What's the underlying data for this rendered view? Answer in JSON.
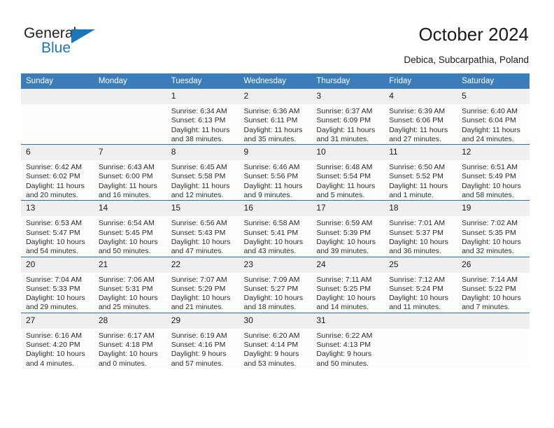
{
  "brand": {
    "name_top": "General",
    "name_bottom": "Blue",
    "accent_color": "#1b75bb"
  },
  "header": {
    "title": "October 2024",
    "subtitle": "Debica, Subcarpathia, Poland"
  },
  "calendar": {
    "header_color": "#3b7cba",
    "weekdays": [
      "Sunday",
      "Monday",
      "Tuesday",
      "Wednesday",
      "Thursday",
      "Friday",
      "Saturday"
    ],
    "weeks": [
      [
        {
          "day": "",
          "blank": true
        },
        {
          "day": "",
          "blank": true
        },
        {
          "day": "1",
          "sunrise": "Sunrise: 6:34 AM",
          "sunset": "Sunset: 6:13 PM",
          "daylight1": "Daylight: 11 hours",
          "daylight2": "and 38 minutes."
        },
        {
          "day": "2",
          "sunrise": "Sunrise: 6:36 AM",
          "sunset": "Sunset: 6:11 PM",
          "daylight1": "Daylight: 11 hours",
          "daylight2": "and 35 minutes."
        },
        {
          "day": "3",
          "sunrise": "Sunrise: 6:37 AM",
          "sunset": "Sunset: 6:09 PM",
          "daylight1": "Daylight: 11 hours",
          "daylight2": "and 31 minutes."
        },
        {
          "day": "4",
          "sunrise": "Sunrise: 6:39 AM",
          "sunset": "Sunset: 6:06 PM",
          "daylight1": "Daylight: 11 hours",
          "daylight2": "and 27 minutes."
        },
        {
          "day": "5",
          "sunrise": "Sunrise: 6:40 AM",
          "sunset": "Sunset: 6:04 PM",
          "daylight1": "Daylight: 11 hours",
          "daylight2": "and 24 minutes."
        }
      ],
      [
        {
          "day": "6",
          "sunrise": "Sunrise: 6:42 AM",
          "sunset": "Sunset: 6:02 PM",
          "daylight1": "Daylight: 11 hours",
          "daylight2": "and 20 minutes."
        },
        {
          "day": "7",
          "sunrise": "Sunrise: 6:43 AM",
          "sunset": "Sunset: 6:00 PM",
          "daylight1": "Daylight: 11 hours",
          "daylight2": "and 16 minutes."
        },
        {
          "day": "8",
          "sunrise": "Sunrise: 6:45 AM",
          "sunset": "Sunset: 5:58 PM",
          "daylight1": "Daylight: 11 hours",
          "daylight2": "and 12 minutes."
        },
        {
          "day": "9",
          "sunrise": "Sunrise: 6:46 AM",
          "sunset": "Sunset: 5:56 PM",
          "daylight1": "Daylight: 11 hours",
          "daylight2": "and 9 minutes."
        },
        {
          "day": "10",
          "sunrise": "Sunrise: 6:48 AM",
          "sunset": "Sunset: 5:54 PM",
          "daylight1": "Daylight: 11 hours",
          "daylight2": "and 5 minutes."
        },
        {
          "day": "11",
          "sunrise": "Sunrise: 6:50 AM",
          "sunset": "Sunset: 5:52 PM",
          "daylight1": "Daylight: 11 hours",
          "daylight2": "and 1 minute."
        },
        {
          "day": "12",
          "sunrise": "Sunrise: 6:51 AM",
          "sunset": "Sunset: 5:49 PM",
          "daylight1": "Daylight: 10 hours",
          "daylight2": "and 58 minutes."
        }
      ],
      [
        {
          "day": "13",
          "sunrise": "Sunrise: 6:53 AM",
          "sunset": "Sunset: 5:47 PM",
          "daylight1": "Daylight: 10 hours",
          "daylight2": "and 54 minutes."
        },
        {
          "day": "14",
          "sunrise": "Sunrise: 6:54 AM",
          "sunset": "Sunset: 5:45 PM",
          "daylight1": "Daylight: 10 hours",
          "daylight2": "and 50 minutes."
        },
        {
          "day": "15",
          "sunrise": "Sunrise: 6:56 AM",
          "sunset": "Sunset: 5:43 PM",
          "daylight1": "Daylight: 10 hours",
          "daylight2": "and 47 minutes."
        },
        {
          "day": "16",
          "sunrise": "Sunrise: 6:58 AM",
          "sunset": "Sunset: 5:41 PM",
          "daylight1": "Daylight: 10 hours",
          "daylight2": "and 43 minutes."
        },
        {
          "day": "17",
          "sunrise": "Sunrise: 6:59 AM",
          "sunset": "Sunset: 5:39 PM",
          "daylight1": "Daylight: 10 hours",
          "daylight2": "and 39 minutes."
        },
        {
          "day": "18",
          "sunrise": "Sunrise: 7:01 AM",
          "sunset": "Sunset: 5:37 PM",
          "daylight1": "Daylight: 10 hours",
          "daylight2": "and 36 minutes."
        },
        {
          "day": "19",
          "sunrise": "Sunrise: 7:02 AM",
          "sunset": "Sunset: 5:35 PM",
          "daylight1": "Daylight: 10 hours",
          "daylight2": "and 32 minutes."
        }
      ],
      [
        {
          "day": "20",
          "sunrise": "Sunrise: 7:04 AM",
          "sunset": "Sunset: 5:33 PM",
          "daylight1": "Daylight: 10 hours",
          "daylight2": "and 29 minutes."
        },
        {
          "day": "21",
          "sunrise": "Sunrise: 7:06 AM",
          "sunset": "Sunset: 5:31 PM",
          "daylight1": "Daylight: 10 hours",
          "daylight2": "and 25 minutes."
        },
        {
          "day": "22",
          "sunrise": "Sunrise: 7:07 AM",
          "sunset": "Sunset: 5:29 PM",
          "daylight1": "Daylight: 10 hours",
          "daylight2": "and 21 minutes."
        },
        {
          "day": "23",
          "sunrise": "Sunrise: 7:09 AM",
          "sunset": "Sunset: 5:27 PM",
          "daylight1": "Daylight: 10 hours",
          "daylight2": "and 18 minutes."
        },
        {
          "day": "24",
          "sunrise": "Sunrise: 7:11 AM",
          "sunset": "Sunset: 5:25 PM",
          "daylight1": "Daylight: 10 hours",
          "daylight2": "and 14 minutes."
        },
        {
          "day": "25",
          "sunrise": "Sunrise: 7:12 AM",
          "sunset": "Sunset: 5:24 PM",
          "daylight1": "Daylight: 10 hours",
          "daylight2": "and 11 minutes."
        },
        {
          "day": "26",
          "sunrise": "Sunrise: 7:14 AM",
          "sunset": "Sunset: 5:22 PM",
          "daylight1": "Daylight: 10 hours",
          "daylight2": "and 7 minutes."
        }
      ],
      [
        {
          "day": "27",
          "sunrise": "Sunrise: 6:16 AM",
          "sunset": "Sunset: 4:20 PM",
          "daylight1": "Daylight: 10 hours",
          "daylight2": "and 4 minutes."
        },
        {
          "day": "28",
          "sunrise": "Sunrise: 6:17 AM",
          "sunset": "Sunset: 4:18 PM",
          "daylight1": "Daylight: 10 hours",
          "daylight2": "and 0 minutes."
        },
        {
          "day": "29",
          "sunrise": "Sunrise: 6:19 AM",
          "sunset": "Sunset: 4:16 PM",
          "daylight1": "Daylight: 9 hours",
          "daylight2": "and 57 minutes."
        },
        {
          "day": "30",
          "sunrise": "Sunrise: 6:20 AM",
          "sunset": "Sunset: 4:14 PM",
          "daylight1": "Daylight: 9 hours",
          "daylight2": "and 53 minutes."
        },
        {
          "day": "31",
          "sunrise": "Sunrise: 6:22 AM",
          "sunset": "Sunset: 4:13 PM",
          "daylight1": "Daylight: 9 hours",
          "daylight2": "and 50 minutes."
        },
        {
          "day": "",
          "blank": true
        },
        {
          "day": "",
          "blank": true
        }
      ]
    ]
  }
}
